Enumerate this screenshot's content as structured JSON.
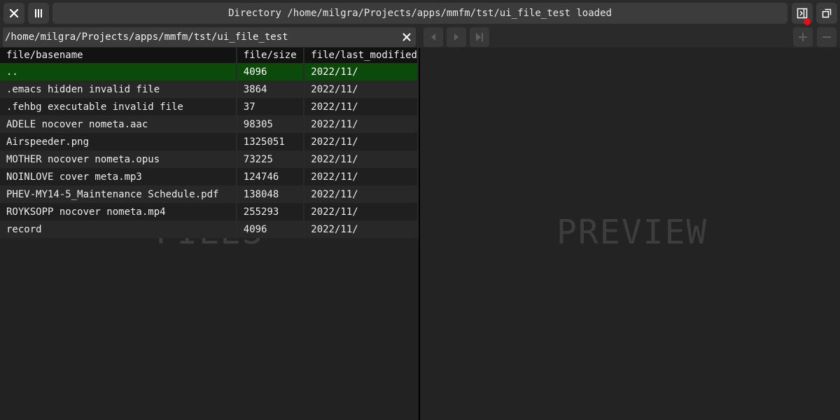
{
  "window": {
    "title": "Directory /home/milgra/Projects/apps/mmfm/tst/ui_file_test loaded",
    "icons": {
      "close": "close-icon",
      "columns": "columns-icon",
      "toggle_preview": "sidebar-toggle-icon",
      "fullscreen": "fullscreen-icon"
    },
    "record_indicator_color": "#e0101a"
  },
  "pathbar": {
    "value": "/home/milgra/Projects/apps/mmfm/tst/ui_file_test",
    "clear_icon": "clear-icon",
    "nav_icons": [
      "previous-icon",
      "play-icon",
      "next-icon"
    ],
    "zoom_icons": [
      "zoom-in-icon",
      "zoom-out-icon"
    ]
  },
  "files": {
    "watermark": "FILES",
    "columns": [
      "file/basename",
      "file/size",
      "file/last_modified"
    ],
    "rows": [
      {
        "name": "..",
        "size": "4096",
        "date": "2022/11/"
      },
      {
        "name": ".emacs hidden invalid file",
        "size": "3864",
        "date": "2022/11/"
      },
      {
        "name": ".fehbg executable invalid file",
        "size": "37",
        "date": "2022/11/"
      },
      {
        "name": "ADELE nocover nometa.aac",
        "size": "98305",
        "date": "2022/11/"
      },
      {
        "name": "Airspeeder.png",
        "size": "1325051",
        "date": "2022/11/"
      },
      {
        "name": "MOTHER nocover nometa.opus",
        "size": "73225",
        "date": "2022/11/"
      },
      {
        "name": "NOINLOVE cover meta.mp3",
        "size": "124746",
        "date": "2022/11/"
      },
      {
        "name": "PHEV-MY14-5_Maintenance Schedule.pdf",
        "size": "138048",
        "date": "2022/11/"
      },
      {
        "name": "ROYKSOPP nocover nometa.mp4",
        "size": "255293",
        "date": "2022/11/"
      },
      {
        "name": "record",
        "size": "4096",
        "date": "2022/11/"
      }
    ],
    "selected_index": 0,
    "selected_color": "#0c4a0c"
  },
  "preview": {
    "watermark": "PREVIEW"
  }
}
